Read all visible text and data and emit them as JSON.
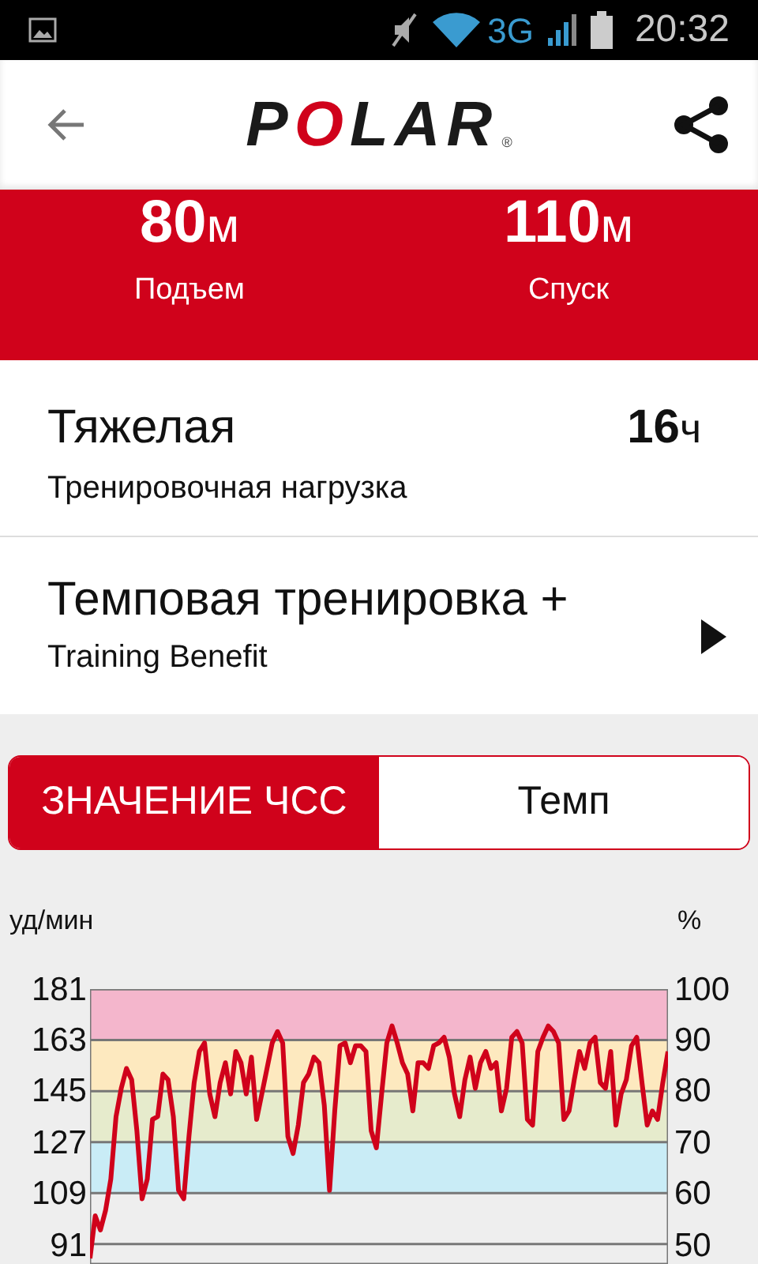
{
  "status_bar": {
    "network": "3G",
    "time": "20:32"
  },
  "header": {
    "logo": "POLAR",
    "logo_mark": "®"
  },
  "stats": [
    {
      "value": "80",
      "unit": "м",
      "label": "Подъем"
    },
    {
      "value": "110",
      "unit": "м",
      "label": "Спуск"
    }
  ],
  "load": {
    "title": "Тяжелая",
    "subtitle": "Тренировочная нагрузка",
    "value": "16",
    "unit": "ч"
  },
  "benefit": {
    "title": "Темповая тренировка +",
    "subtitle": "Training Benefit"
  },
  "tabs": [
    {
      "label": "ЗНАЧЕНИЕ ЧСС",
      "selected": true
    },
    {
      "label": "Темп",
      "selected": false
    }
  ],
  "chart": {
    "chart_data": {
      "type": "line",
      "ylabel": "уд/мин",
      "ylim": [
        84,
        181
      ],
      "yticks": [
        181,
        163,
        145,
        127,
        109,
        91
      ],
      "grid": true,
      "bands": [
        {
          "axis": "y",
          "from": 163,
          "to": 181,
          "color": "#f4b6cc"
        },
        {
          "axis": "y",
          "from": 145,
          "to": 163,
          "color": "#fde9bf"
        },
        {
          "axis": "y",
          "from": 127,
          "to": 145,
          "color": "#e6ebcc"
        },
        {
          "axis": "y",
          "from": 109,
          "to": 127,
          "color": "#c9ecf6"
        }
      ],
      "series": [
        {
          "color": "#d0021b",
          "values": [
            86,
            101,
            96,
            103,
            114,
            136,
            146,
            153,
            149,
            131,
            107,
            114,
            135,
            136,
            151,
            149,
            136,
            110,
            107,
            129,
            148,
            159,
            162,
            144,
            136,
            148,
            155,
            144,
            159,
            155,
            144,
            157,
            135,
            144,
            153,
            162,
            166,
            162,
            129,
            123,
            133,
            148,
            151,
            157,
            155,
            140,
            110,
            138,
            161,
            162,
            155,
            161,
            161,
            159,
            131,
            125,
            144,
            162,
            168,
            162,
            155,
            151,
            138,
            155,
            155,
            153,
            161,
            162,
            164,
            157,
            144,
            136,
            149,
            157,
            146,
            155,
            159,
            153,
            155,
            138,
            146,
            164,
            166,
            162,
            135,
            133,
            159,
            164,
            168,
            166,
            162,
            135,
            138,
            149,
            159,
            153,
            162,
            164,
            148,
            146,
            159,
            133,
            144,
            149,
            161,
            164,
            148,
            133,
            138,
            135,
            148,
            159
          ]
        }
      ]
    },
    "right_axis": {
      "label": "%",
      "ticks": [
        "100",
        "90",
        "80",
        "70",
        "60",
        "50"
      ]
    }
  }
}
